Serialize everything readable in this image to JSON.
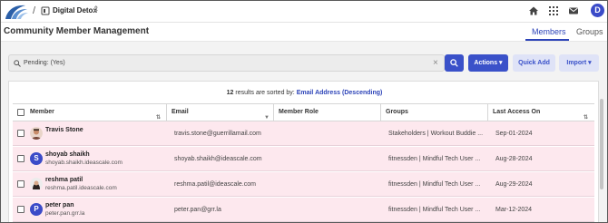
{
  "header": {
    "workspace_name": "Digital Detox",
    "crumb_separator": "/",
    "avatar_letter": "D",
    "icons": [
      "home-icon",
      "grid-icon",
      "mail-icon"
    ]
  },
  "page": {
    "title": "Community Member Management",
    "tabs": [
      {
        "label": "Members",
        "active": true
      },
      {
        "label": "Groups",
        "active": false
      }
    ]
  },
  "filter": {
    "search_value": "Pending: (Yes)",
    "clear_symbol": "×",
    "actions_label": "Actions ▾",
    "quick_add_label": "Quick Add",
    "import_label": "Import ▾"
  },
  "results": {
    "count": "12",
    "text": " results are sorted by: ",
    "sort_field": "Email Address (Descending)"
  },
  "table": {
    "columns": [
      "Member",
      "Email",
      "Member Role",
      "Groups",
      "Last Access On"
    ],
    "rows": [
      {
        "name": "Travis Stone",
        "username": "",
        "email": "travis.stone@guerrillamail.com",
        "role": "",
        "groups": "Stakeholders | Workout Buddie ...",
        "last_access": "Sep-01-2024",
        "avatar": "photo"
      },
      {
        "name": "shoyab shaikh",
        "username": "shoyab.shaikh.ideascale.com",
        "email": "shoyab.shaikh@ideascale.com",
        "role": "",
        "groups": "fitnessden | Mindful Tech User ...",
        "last_access": "Aug-28-2024",
        "avatar": "S"
      },
      {
        "name": "reshma patil",
        "username": "reshma.patil.ideascale.com",
        "email": "reshma.patil@ideascale.com",
        "role": "",
        "groups": "fitnessden | Mindful Tech User ...",
        "last_access": "Aug-29-2024",
        "avatar": "photo"
      },
      {
        "name": "peter pan",
        "username": "peter.pan.grr.la",
        "email": "peter.pan@grr.la",
        "role": "",
        "groups": "fitnessden | Mindful Tech User ...",
        "last_access": "Mar-12-2024",
        "avatar": "P"
      }
    ]
  },
  "colors": {
    "primary": "#3a51c9",
    "row_highlight": "#fde8ee",
    "light_button": "#dfe3f7"
  }
}
